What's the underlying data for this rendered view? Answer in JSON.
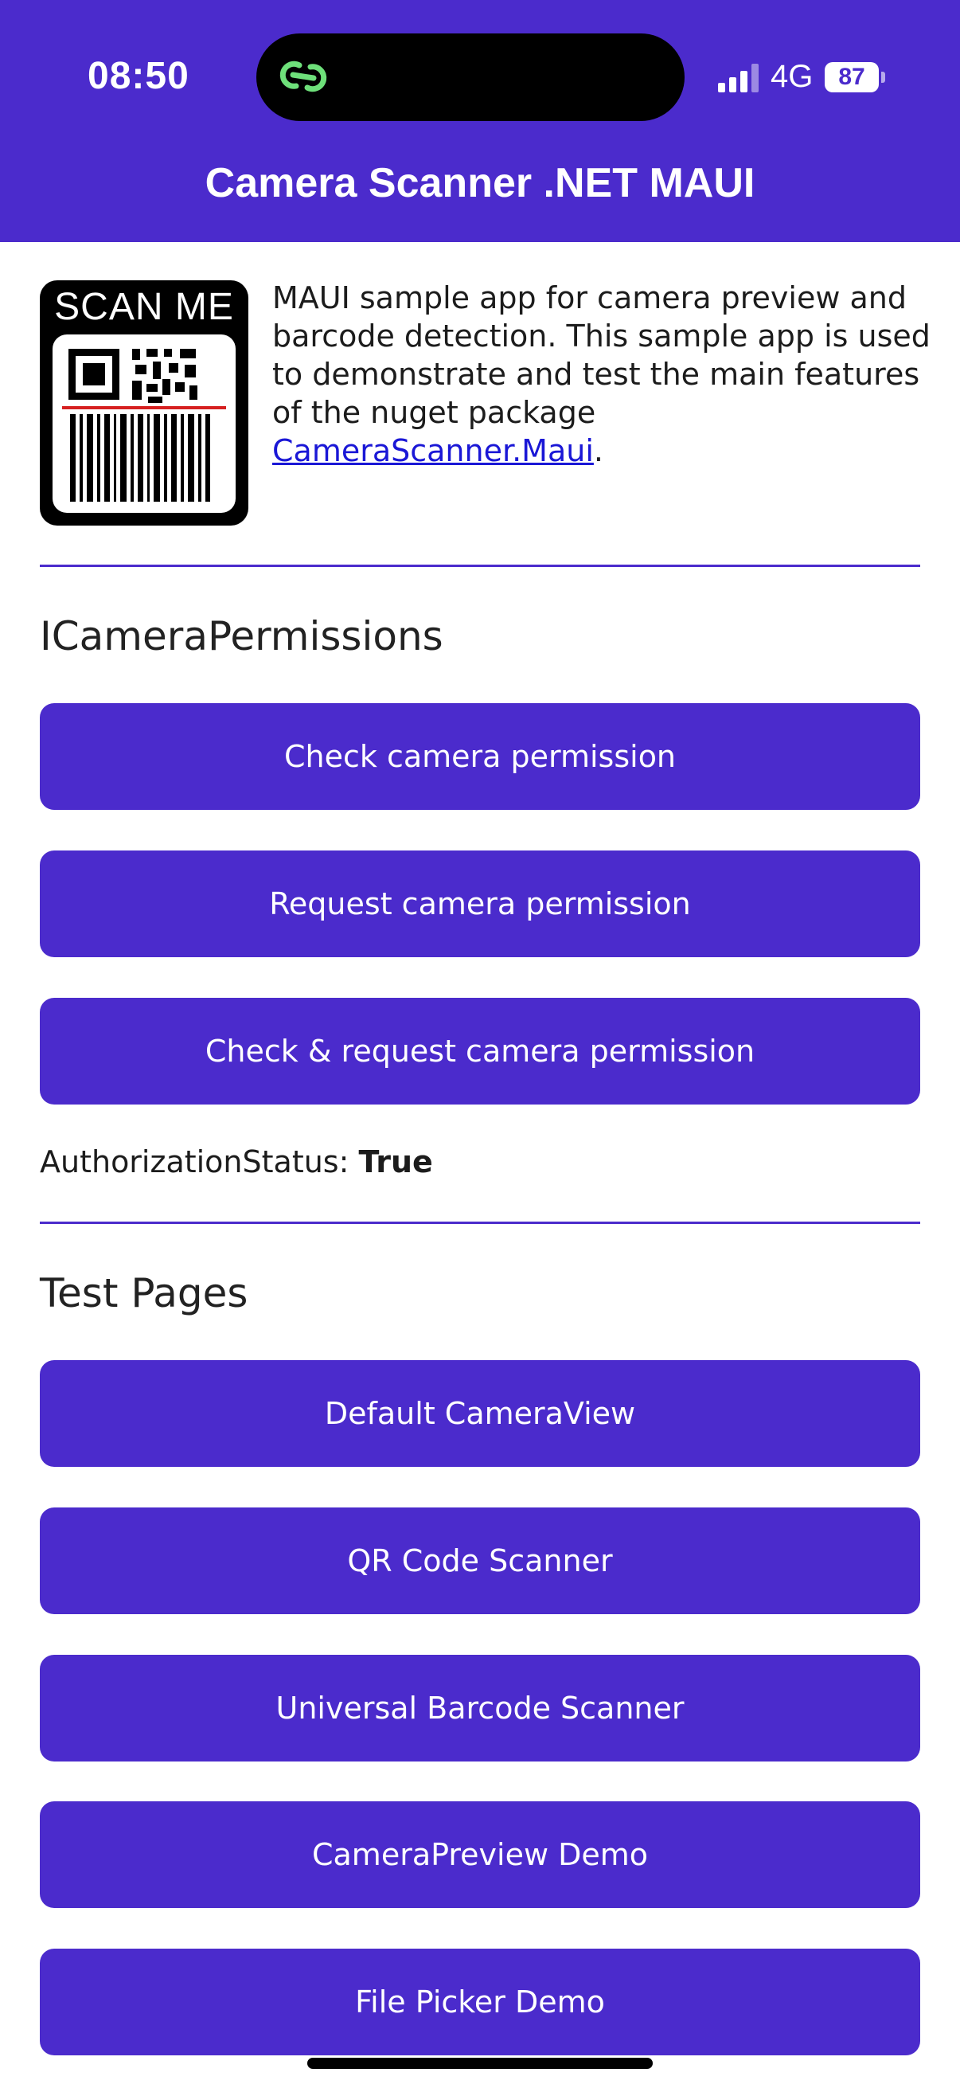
{
  "status_bar": {
    "time": "08:50",
    "network": "4G",
    "battery": "87",
    "island_icon": "link-icon"
  },
  "app": {
    "title": "Camera Scanner .NET MAUI"
  },
  "intro": {
    "logo_text": "SCAN ME",
    "description": "MAUI sample app for camera preview and barcode detection. This sample app is used to demonstrate and test the main features of the nuget package ",
    "link_text": "CameraScanner.Maui",
    "trailing": "."
  },
  "permissions": {
    "title": "ICameraPermissions",
    "buttons": [
      {
        "label": "Check camera permission"
      },
      {
        "label": "Request camera permission"
      },
      {
        "label": "Check & request camera permission"
      }
    ],
    "status_label": "AuthorizationStatus: ",
    "status_value": "True"
  },
  "test_pages": {
    "title": "Test Pages",
    "buttons": [
      {
        "label": "Default CameraView"
      },
      {
        "label": "QR Code Scanner"
      },
      {
        "label": "Universal Barcode Scanner"
      },
      {
        "label": "CameraPreview Demo"
      },
      {
        "label": "File Picker Demo"
      }
    ]
  },
  "colors": {
    "accent": "#4b2bcc",
    "link": "#1a17d6",
    "island_icon": "#6ee07a",
    "scan_line": "#d62020"
  }
}
